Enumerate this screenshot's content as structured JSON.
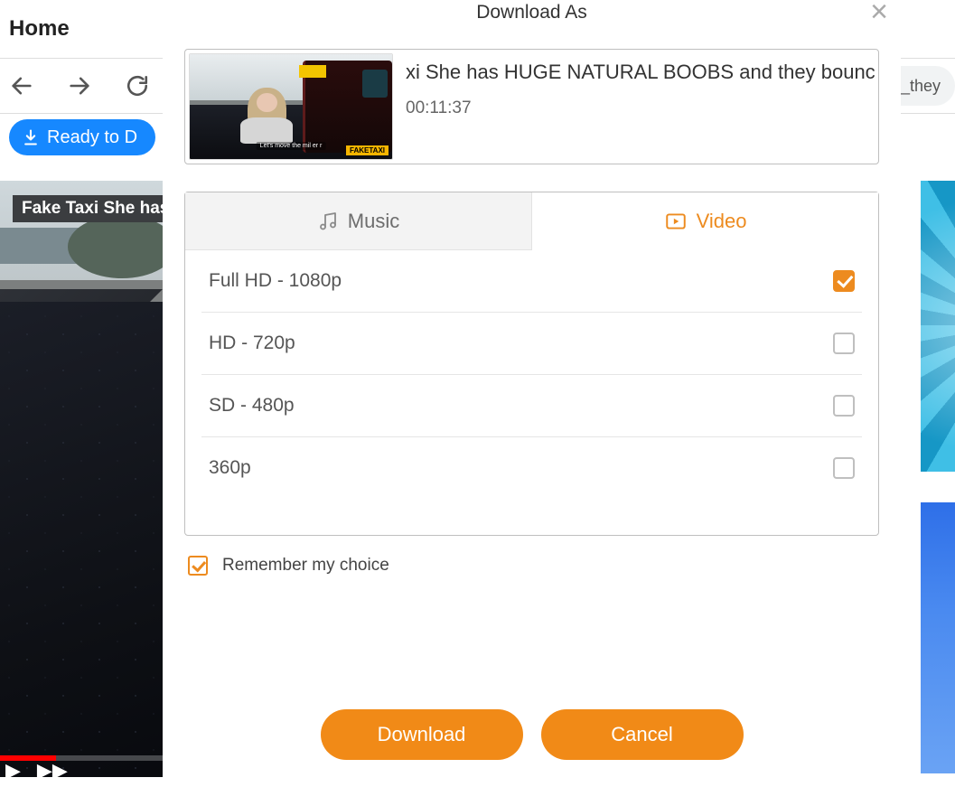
{
  "background": {
    "home_label": "Home",
    "url_text": "l_they",
    "ready_label": "Ready to D",
    "video_chip": "Fake Taxi She has"
  },
  "modal": {
    "title": "Download As",
    "item_title": "xi She has HUGE NATURAL BOOBS and they bounce a",
    "duration": "00:11:37",
    "thumb_badge": "FAKETAXI",
    "thumb_caption": "Let's move the mil er r",
    "tabs": {
      "music": "Music",
      "video": "Video"
    },
    "qualities": [
      {
        "label": "Full HD - 1080p",
        "checked": true
      },
      {
        "label": "HD - 720p",
        "checked": false
      },
      {
        "label": "SD - 480p",
        "checked": false
      },
      {
        "label": "360p",
        "checked": false
      }
    ],
    "remember_label": "Remember my choice",
    "remember_checked": true,
    "download_label": "Download",
    "cancel_label": "Cancel"
  }
}
